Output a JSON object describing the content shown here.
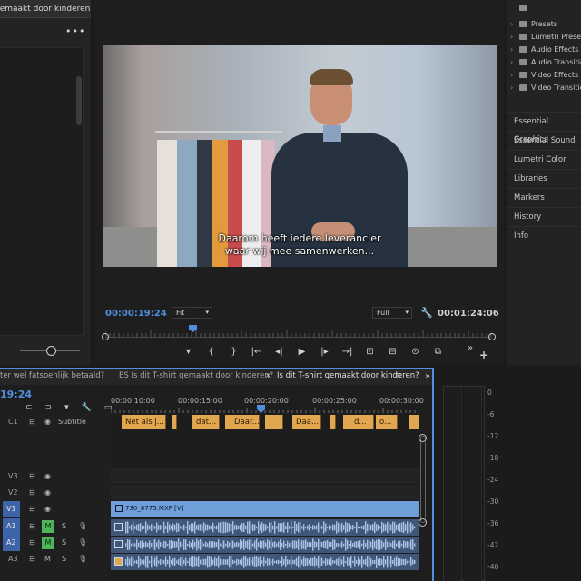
{
  "source_panel": {
    "tab_title": "gemaakt door kinderen?",
    "more_label": "•••"
  },
  "program_monitor": {
    "subtitle_line1": "Daarom heeft iedere leverancier",
    "subtitle_line2": "waar wij mee samenwerken...",
    "current_timecode": "00:00:19:24",
    "zoom_value": "Fit",
    "resolution_value": "Full",
    "duration_timecode": "00:01:24:06",
    "transport_icons": [
      "marker-icon",
      "mark-in-icon",
      "mark-out-icon",
      "go-to-in-icon",
      "step-back-icon",
      "play-icon",
      "step-forward-icon",
      "go-to-out-icon",
      "lift-icon",
      "extract-icon",
      "export-frame-icon",
      "compare-icon"
    ],
    "transport_glyphs": [
      "▾",
      "{",
      "}",
      "|←",
      "◂|",
      "▶",
      "|▸",
      "→|",
      "⊡",
      "⊟",
      "⊙",
      "⧉"
    ],
    "more_label": "»",
    "add_label": "+"
  },
  "right_panel": {
    "effects": [
      "Presets",
      "Lumetri Presets",
      "Audio Effects",
      "Audio Transitions",
      "Video Effects",
      "Video Transitions"
    ],
    "panels": [
      "Essential Graphics",
      "Essential Sound",
      "Lumetri Color",
      "Libraries",
      "Markers",
      "History",
      "Info"
    ]
  },
  "timeline": {
    "tabs": [
      "ter wel fatsoenlijk betaald?",
      "ES Is dit T-shirt gemaakt door kinderen?",
      "Is dit T-shirt gemaakt door kinderen?"
    ],
    "active_tab_index": 2,
    "close_label": "×",
    "menu_label": "≡",
    "more_label": "»",
    "sequence_timecode": "19:24",
    "ruler_labels": [
      "00:00:10:00",
      "00:00:15:00",
      "00:00:20:00",
      "00:00:25:00",
      "00:00:30:00"
    ],
    "subtitle_track": {
      "name": "C1",
      "label": "Subtitle"
    },
    "subtitle_clips": [
      "Net als j...",
      "",
      "dat...",
      "",
      "Daar...",
      "",
      "Daa...",
      "",
      "",
      "d...",
      "o...",
      ""
    ],
    "video_tracks": [
      "V3",
      "V2",
      "V1"
    ],
    "audio_tracks": [
      "A1",
      "A2",
      "A3"
    ],
    "video_clip_name": "730_8775.MXF [V]",
    "mute_label": "M",
    "solo_label": "S"
  },
  "meters": {
    "db_labels": [
      "0",
      "-6",
      "-12",
      "-18",
      "-24",
      "-30",
      "-36",
      "-42",
      "-48"
    ]
  },
  "colors": {
    "accent_blue": "#4e8fe0",
    "subtitle_clip": "#e0a750",
    "video_clip": "#6f9fd8",
    "audio_clip": "#40577a",
    "mute_green": "#4fb35a"
  }
}
